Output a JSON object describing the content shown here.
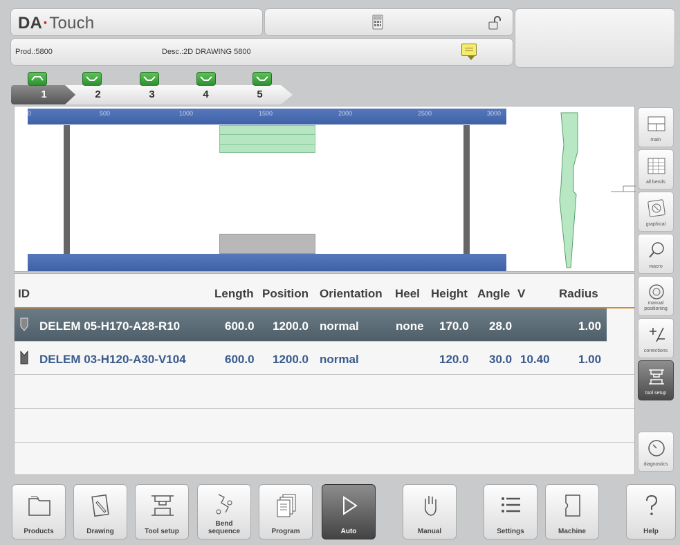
{
  "app": {
    "title_part1": "DA",
    "title_dot": "·",
    "title_part2": "Touch"
  },
  "header": {
    "product": "Prod.:5800",
    "description": "Desc.:2D DRAWING 5800",
    "calculator_icon": "calculator-icon",
    "lock_icon": "unlocked-padlock-icon",
    "note_icon": "note-icon"
  },
  "bend_tabs": [
    {
      "label": "1",
      "icon": "bend-up-icon",
      "active": true
    },
    {
      "label": "2",
      "icon": "bend-down-icon",
      "active": false
    },
    {
      "label": "3",
      "icon": "bend-down-icon",
      "active": false
    },
    {
      "label": "4",
      "icon": "bend-down-icon",
      "active": false
    },
    {
      "label": "5",
      "icon": "bend-down-icon",
      "active": false
    }
  ],
  "graphic": {
    "ruler_ticks": [
      "0",
      "500",
      "1000",
      "1500",
      "2000",
      "2500",
      "3000"
    ],
    "colors": {
      "ruler": "#4467ab",
      "tool": "#b8e8c3",
      "die": "#b7b7b7"
    }
  },
  "table": {
    "columns": {
      "id": "ID",
      "length": "Length",
      "position": "Position",
      "orientation": "Orientation",
      "heel": "Heel",
      "height": "Height",
      "angle": "Angle",
      "v": "V",
      "radius": "Radius"
    },
    "rows": [
      {
        "id": "DELEM 05-H170-A28-R10",
        "length": "600.0",
        "position": "1200.0",
        "orientation": "normal",
        "heel": "none",
        "height": "170.0",
        "angle": "28.0",
        "v": "",
        "radius": "1.00",
        "selected": true,
        "icon": "punch-icon"
      },
      {
        "id": "DELEM 03-H120-A30-V104",
        "length": "600.0",
        "position": "1200.0",
        "orientation": "normal",
        "heel": "",
        "height": "120.0",
        "angle": "30.0",
        "v": "10.40",
        "radius": "1.00",
        "selected": false,
        "icon": "die-icon"
      }
    ]
  },
  "side_buttons": [
    {
      "label": "main",
      "icon": "main-view-icon"
    },
    {
      "label": "all bends",
      "icon": "table-icon"
    },
    {
      "label": "graphical",
      "icon": "graphical-icon"
    },
    {
      "label": "macro",
      "icon": "magnifier-icon"
    },
    {
      "label": "manual positioning",
      "icon": "dial-icon"
    },
    {
      "label": "corrections",
      "icon": "plus-minus-icon"
    },
    {
      "label": "tool setup",
      "icon": "tool-setup-icon",
      "active": true
    },
    {
      "label": "diagnostics",
      "icon": "gauge-icon"
    }
  ],
  "nav": {
    "products": "Products",
    "drawing": "Drawing",
    "tool_setup": "Tool setup",
    "bend_sequence_1": "Bend",
    "bend_sequence_2": "sequence",
    "program": "Program",
    "auto": "Auto",
    "manual": "Manual",
    "settings": "Settings",
    "machine": "Machine",
    "help": "Help"
  }
}
